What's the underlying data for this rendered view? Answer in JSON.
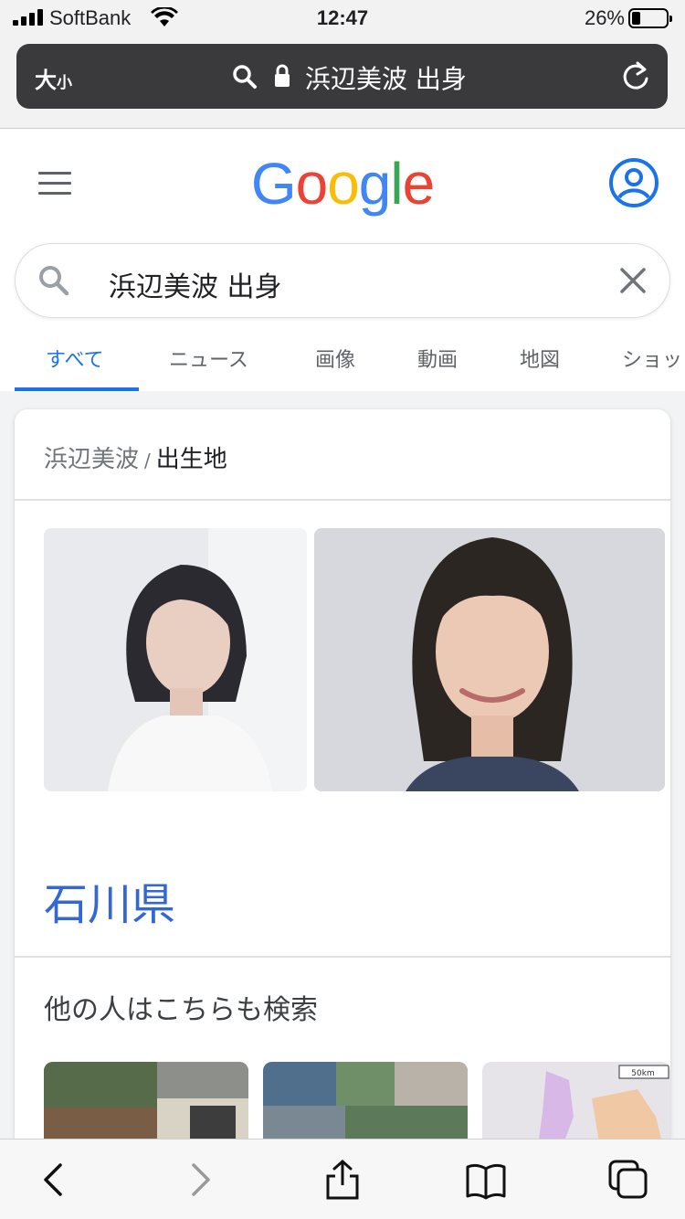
{
  "status_bar": {
    "carrier": "SoftBank",
    "time": "12:47",
    "battery_percent": "26%",
    "battery_level": 0.26,
    "signal_bars": 4
  },
  "browser": {
    "text_size_label_big": "大",
    "text_size_label_small": "小",
    "url_text": "浜辺美波 出身",
    "icons": [
      "search-icon",
      "lock-icon",
      "reload-icon"
    ]
  },
  "google": {
    "logo_letters": [
      {
        "char": "G",
        "color": "#4285F4"
      },
      {
        "char": "o",
        "color": "#EA4335"
      },
      {
        "char": "o",
        "color": "#FBBC05"
      },
      {
        "char": "g",
        "color": "#4285F4"
      },
      {
        "char": "l",
        "color": "#34A853"
      },
      {
        "char": "e",
        "color": "#EA4335"
      }
    ],
    "search_query": "浜辺美波 出身",
    "accent_color": "#1a73e8"
  },
  "tabs": [
    {
      "label": "すべて",
      "active": true
    },
    {
      "label": "ニュース",
      "active": false
    },
    {
      "label": "画像",
      "active": false
    },
    {
      "label": "動画",
      "active": false
    },
    {
      "label": "地図",
      "active": false
    },
    {
      "label": "ショッ",
      "active": false
    }
  ],
  "knowledge_card": {
    "breadcrumb_entity": "浜辺美波",
    "breadcrumb_separator": "/",
    "breadcrumb_attribute": "出生地",
    "answer": "石川県",
    "answer_color": "#3367d6"
  },
  "people_also_search": {
    "title": "他の人はこちらも検索",
    "map_scale_label": "50km"
  },
  "toolbar": {
    "icons": [
      "back-icon",
      "forward-icon",
      "share-icon",
      "bookmarks-icon",
      "tabs-icon"
    ]
  }
}
